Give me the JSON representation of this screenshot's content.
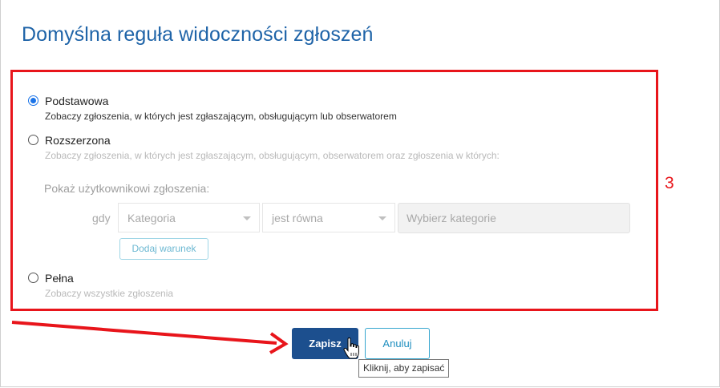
{
  "dialog": {
    "title": "Domyślna reguła widoczności zgłoszeń"
  },
  "annotation": {
    "number": "3",
    "color": "#e8151b"
  },
  "options": [
    {
      "label": "Podstawowa",
      "description": "Zobaczy zgłoszenia, w których jest zgłaszającym, obsługującym lub obserwatorem",
      "selected": true
    },
    {
      "label": "Rozszerzona",
      "description": "Zobaczy zgłoszenia, w których jest zgłaszającym, obsługującym, obserwatorem oraz zgłoszenia w których:",
      "selected": false
    },
    {
      "label": "Pełna",
      "description": "Zobaczy wszystkie zgłoszenia",
      "selected": false
    }
  ],
  "extended": {
    "subheading": "Pokaż użytkownikowi zgłoszenia:",
    "when_label": "gdy",
    "field_select": "Kategoria",
    "operator_select": "jest równa",
    "value_placeholder": "Wybierz kategorie",
    "add_condition_label": "Dodaj warunek"
  },
  "footer": {
    "save_label": "Zapisz",
    "cancel_label": "Anuluj",
    "tooltip": "Kliknij, aby zapisać"
  },
  "colors": {
    "title": "#1f64a8",
    "primary_button": "#1c4f8e",
    "secondary_border": "#36a6cf",
    "radio_selected": "#1a73e8"
  },
  "icons": [
    "radio-selected-icon",
    "radio-unselected-icon",
    "chevron-down-icon",
    "hand-pointer-icon",
    "red-arrow-icon"
  ]
}
